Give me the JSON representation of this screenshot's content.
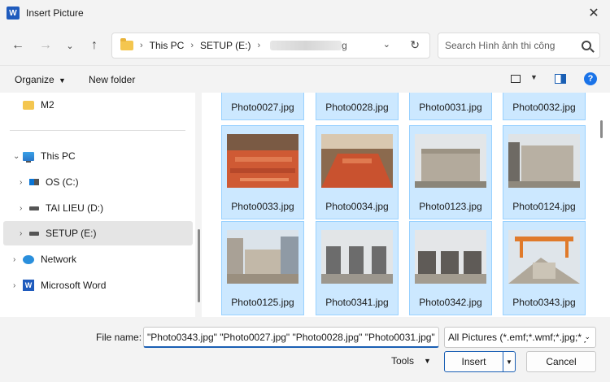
{
  "window": {
    "title": "Insert Picture",
    "app_icon_letter": "W"
  },
  "nav": {
    "breadcrumb": [
      "This PC",
      "SETUP (E:)"
    ],
    "breadcrumb_last_visible_suffix": "g",
    "search_placeholder": "Search Hình ảnh thi công"
  },
  "toolbar": {
    "organize": "Organize",
    "new_folder": "New folder",
    "help": "?"
  },
  "sidebar": {
    "items": [
      {
        "label": "M2",
        "icon": "folder-icon"
      },
      {
        "label": "This PC",
        "icon": "pc-icon"
      },
      {
        "label": "OS (C:)",
        "icon": "os-drive-icon"
      },
      {
        "label": "TAI LIEU (D:)",
        "icon": "drive-icon"
      },
      {
        "label": "SETUP (E:)",
        "icon": "drive-icon",
        "selected": true
      },
      {
        "label": "Network",
        "icon": "network-icon"
      },
      {
        "label": "Microsoft Word",
        "icon": "word-icon"
      }
    ]
  },
  "files": [
    {
      "name": "Photo0027.jpg",
      "selected": true
    },
    {
      "name": "Photo0028.jpg",
      "selected": true
    },
    {
      "name": "Photo0031.jpg",
      "selected": true
    },
    {
      "name": "Photo0032.jpg",
      "selected": true
    },
    {
      "name": "Photo0033.jpg",
      "selected": true
    },
    {
      "name": "Photo0034.jpg",
      "selected": true
    },
    {
      "name": "Photo0123.jpg",
      "selected": true
    },
    {
      "name": "Photo0124.jpg",
      "selected": true
    },
    {
      "name": "Photo0125.jpg",
      "selected": true
    },
    {
      "name": "Photo0341.jpg",
      "selected": true
    },
    {
      "name": "Photo0342.jpg",
      "selected": true
    },
    {
      "name": "Photo0343.jpg",
      "selected": true
    }
  ],
  "footer": {
    "file_name_label": "File name:",
    "file_name_value": "\"Photo0343.jpg\" \"Photo0027.jpg\" \"Photo0028.jpg\" \"Photo0031.jpg\"",
    "filter_value": "All Pictures (*.emf;*.wmf;*.jpg;*.j",
    "tools": "Tools",
    "insert": "Insert",
    "cancel": "Cancel"
  },
  "colors": {
    "selection_bg": "#cce8ff",
    "selection_border": "#99d1ff",
    "accent": "#1a5fb4"
  }
}
